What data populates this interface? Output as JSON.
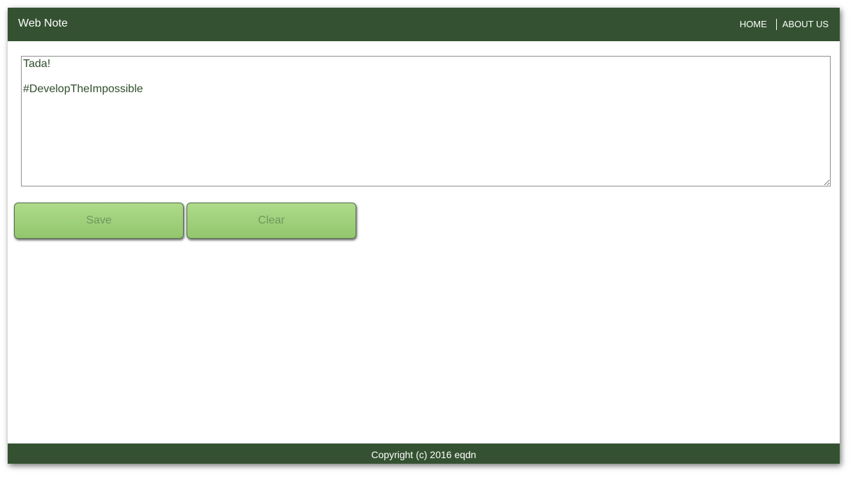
{
  "header": {
    "brand": "Web Note",
    "nav": {
      "home": "HOME",
      "about": "ABOUT US"
    }
  },
  "note": {
    "value": "Tada!\n\n#DevelopTheImpossible"
  },
  "actions": {
    "save_label": "Save",
    "clear_label": "Clear"
  },
  "footer": {
    "copyright": "Copyright (c) 2016 eqdn"
  },
  "colors": {
    "header_bg": "#345231",
    "button_green": "#a0d27a",
    "text_green": "#2f4d2b"
  }
}
